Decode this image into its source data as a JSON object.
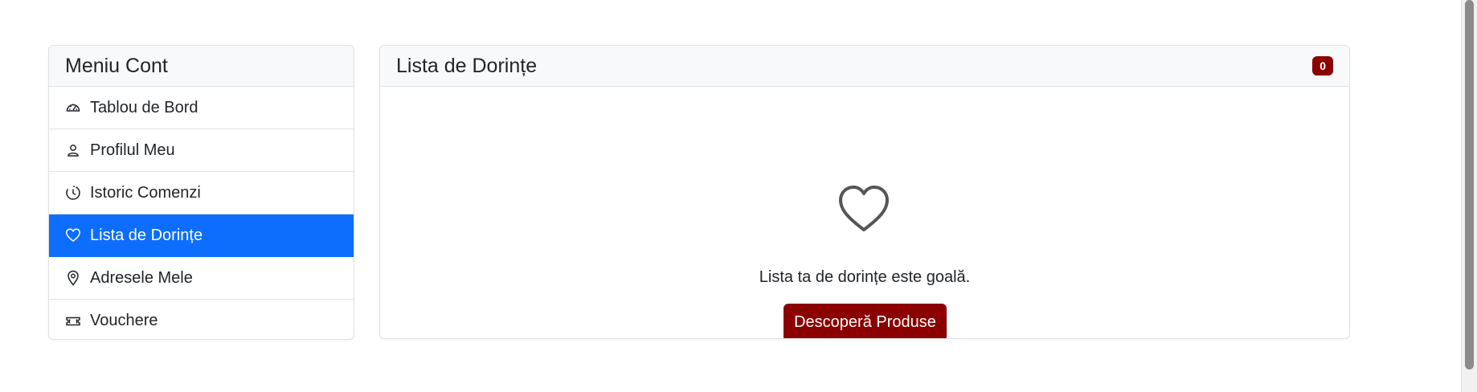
{
  "sidebar": {
    "title": "Meniu Cont",
    "items": [
      {
        "label": "Tablou de Bord",
        "icon": "speedometer-icon"
      },
      {
        "label": "Profilul Meu",
        "icon": "person-icon"
      },
      {
        "label": "Istoric Comenzi",
        "icon": "clock-history-icon"
      },
      {
        "label": "Lista de Dorințe",
        "icon": "heart-icon",
        "active": true
      },
      {
        "label": "Adresele Mele",
        "icon": "location-pin-icon"
      },
      {
        "label": "Vouchere",
        "icon": "ticket-icon"
      }
    ]
  },
  "main": {
    "title": "Lista de Dorințe",
    "count_badge": "0",
    "empty_icon": "heart-icon",
    "empty_message": "Lista ta de dorințe este goală.",
    "discover_label": "Descoperă Produse"
  },
  "colors": {
    "active_item": "#0d6efd",
    "brand_dark_red": "#8b0000",
    "header_bg": "#f8f9fa",
    "border": "#dee2e6"
  }
}
